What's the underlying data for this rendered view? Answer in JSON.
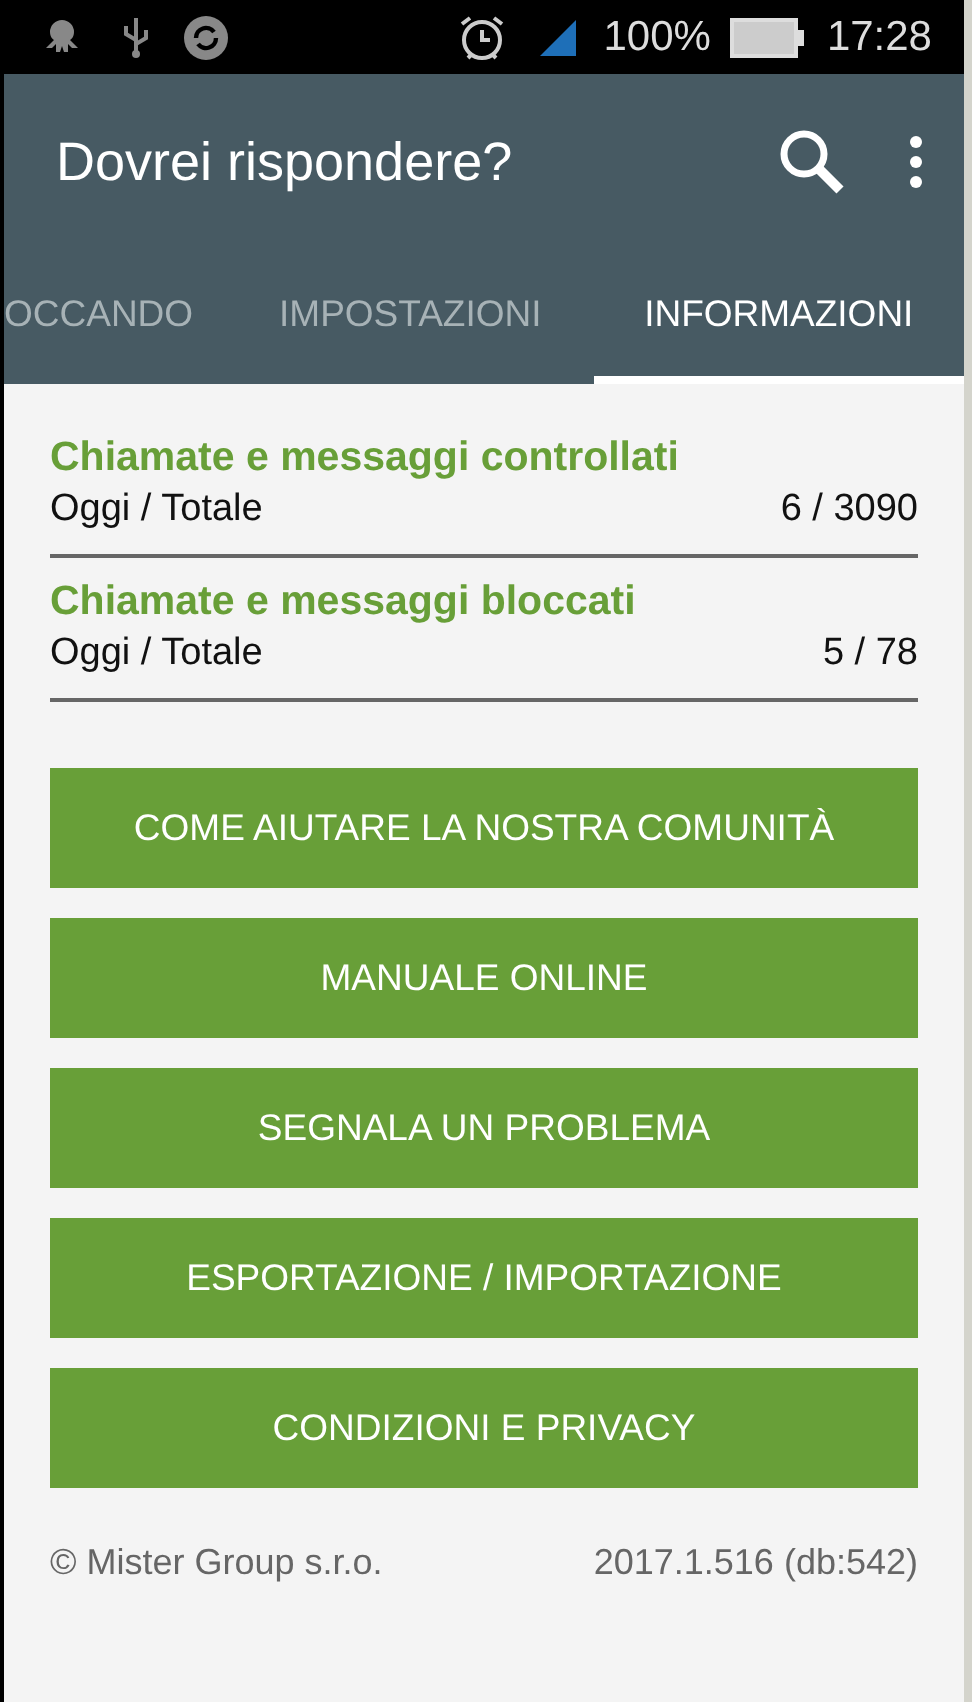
{
  "status_bar": {
    "battery": "100%",
    "time": "17:28"
  },
  "app_bar": {
    "title": "Dovrei rispondere?"
  },
  "tabs": [
    {
      "label": "OCCANDO",
      "selected": false
    },
    {
      "label": "IMPOSTAZIONI",
      "selected": false
    },
    {
      "label": "INFORMAZIONI",
      "selected": true
    }
  ],
  "stats": [
    {
      "title": "Chiamate e messaggi controllati",
      "label": "Oggi / Totale",
      "value": "6 / 3090"
    },
    {
      "title": "Chiamate e messaggi bloccati",
      "label": "Oggi / Totale",
      "value": "5 / 78"
    }
  ],
  "buttons": [
    "COME AIUTARE LA NOSTRA COMUNITÀ",
    "MANUALE ONLINE",
    "SEGNALA UN PROBLEMA",
    "ESPORTAZIONE / IMPORTAZIONE",
    "CONDIZIONI E PRIVACY"
  ],
  "footer": {
    "copyright": "© Mister Group s.r.o.",
    "version": "2017.1.516 (db:542)"
  }
}
